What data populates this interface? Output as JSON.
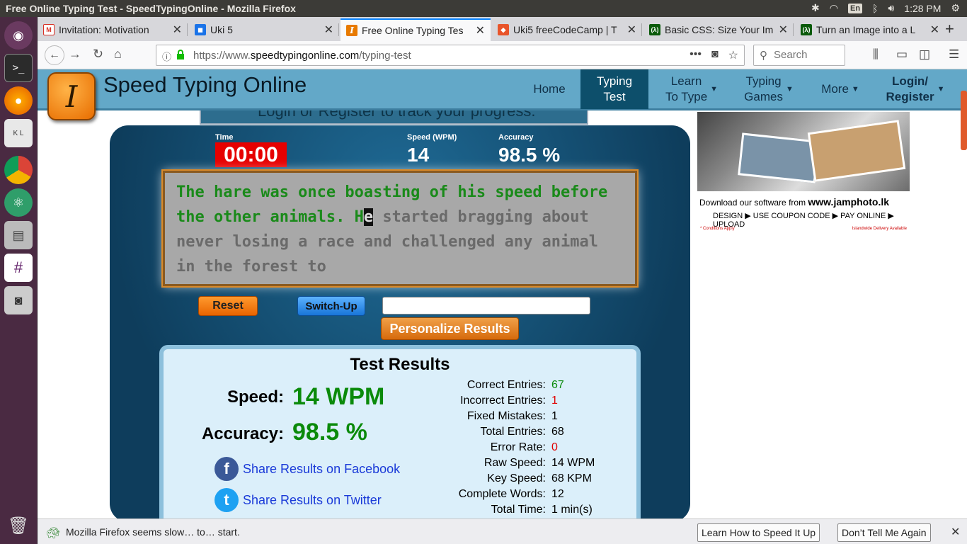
{
  "os": {
    "window_title": "Free Online Typing Test - SpeedTypingOnline - Mozilla Firefox",
    "lang": "En",
    "clock": "1:28 PM"
  },
  "tabs": [
    {
      "label": "Invitation: Motivation",
      "favicon": "gmail-icon",
      "color": "#d93025"
    },
    {
      "label": "Uki 5",
      "favicon": "classroom-icon",
      "color": "#1a73e8"
    },
    {
      "label": "Free Online Typing Tes",
      "favicon": "speedtyping-icon",
      "color": "#e87a00"
    },
    {
      "label": "Uki5 freeCodeCamp | T",
      "favicon": "fcc-icon",
      "color": "#e8542a"
    },
    {
      "label": "Basic CSS: Size Your Im",
      "favicon": "fcc-icon",
      "color": "#0a7a0a"
    },
    {
      "label": "Turn an Image into a L",
      "favicon": "fcc-icon",
      "color": "#0a7a0a"
    }
  ],
  "urlbar": {
    "url_prefix": "https://www.",
    "url_domain": "speedtypingonline.com",
    "url_path": "/typing-test",
    "search_placeholder": "Search"
  },
  "site": {
    "name": "Speed Typing Online",
    "logo_letter": "I",
    "nav": {
      "home": "Home",
      "typing_test_1": "Typing",
      "typing_test_2": "Test",
      "learn_1": "Learn",
      "learn_2": "To Type",
      "games_1": "Typing",
      "games_2": "Games",
      "more": "More",
      "login_1": "Login/",
      "login_2": "Register"
    },
    "login_banner": "Login  or  Register  to track your progress."
  },
  "test": {
    "time_label": "Time",
    "time_value": "00:00",
    "speed_label": "Speed (WPM)",
    "speed_value": "14",
    "accuracy_label": "Accuracy",
    "accuracy_value": "98.5 %",
    "text_typed": "The hare was once boasting of his speed before the other animals. H",
    "text_cursor": "e",
    "text_rest": " started bragging about never losing a race and challenged any animal in the forest to",
    "reset_label": "Reset",
    "switch_label": "Switch-Up",
    "personalize_label": "Personalize Results"
  },
  "results": {
    "title": "Test Results",
    "speed_label": "Speed:",
    "speed_value": "14 WPM",
    "accuracy_label": "Accuracy:",
    "accuracy_value": "98.5 %",
    "share_facebook": "Share Results on Facebook",
    "share_twitter": "Share Results on Twitter",
    "stats": [
      {
        "k": "Correct Entries:",
        "v": "67",
        "c": "green"
      },
      {
        "k": "Incorrect Entries:",
        "v": "1",
        "c": "red"
      },
      {
        "k": "Fixed Mistakes:",
        "v": "1",
        "c": ""
      },
      {
        "k": "Total Entries:",
        "v": "68",
        "c": ""
      },
      {
        "k": "Error Rate:",
        "v": "0",
        "c": "red"
      },
      {
        "k": "Raw Speed:",
        "v": "14 WPM",
        "c": ""
      },
      {
        "k": "Key Speed:",
        "v": "68 KPM",
        "c": ""
      },
      {
        "k": "Complete Words:",
        "v": "12",
        "c": ""
      },
      {
        "k": "Total Time:",
        "v": "1 min(s)",
        "c": ""
      }
    ]
  },
  "ad": {
    "line1_prefix": "Download our software from ",
    "line1_site": "www.jamphoto.lk",
    "line2": "DESIGN ▶ USE COUPON CODE ▶ PAY ONLINE ▶ UPLOAD",
    "line3": "* Conditions Apply",
    "line4": "Islandwide Delivery Available"
  },
  "notification": {
    "text": "Mozilla Firefox seems slow… to… start.",
    "learn_btn": "Learn How to Speed It Up",
    "dont_btn": "Don’t Tell Me Again"
  }
}
